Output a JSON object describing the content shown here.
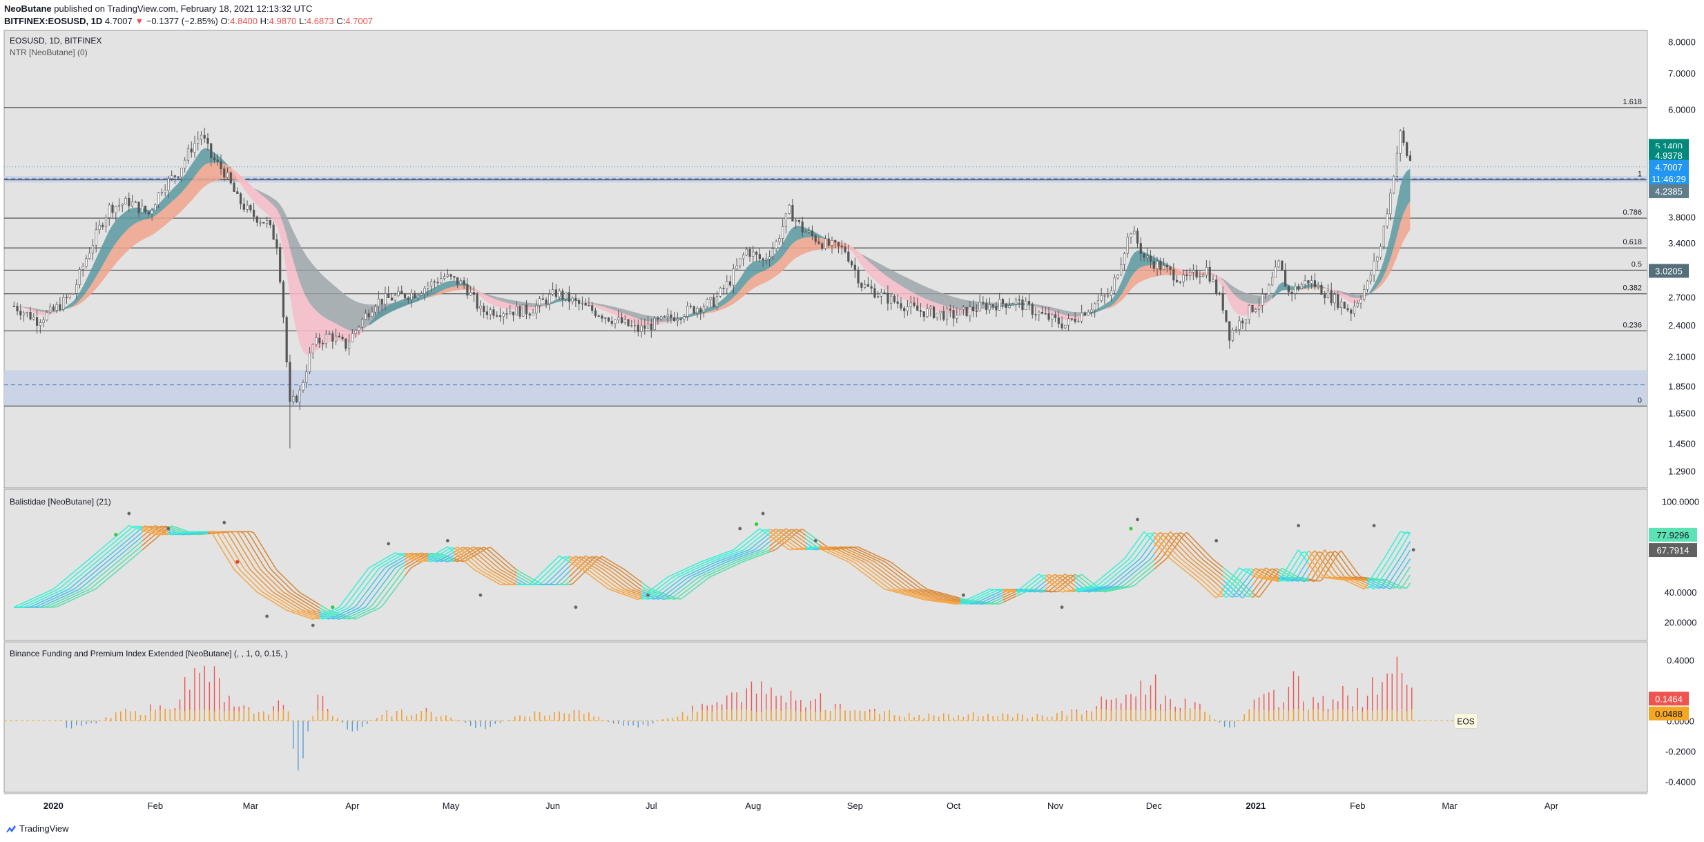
{
  "header": {
    "publisher": "NeoButane",
    "published_text": "published on TradingView.com, February 18, 2021 12:13:32 UTC",
    "symbol": "BITFINEX:EOSUSD, 1D",
    "last": "4.7007",
    "change": "−0.1377 (−2.85%)",
    "o_label": "O:",
    "o": "4.8400",
    "h_label": "H:",
    "h": "4.9870",
    "l_label": "L:",
    "l": "4.6873",
    "c_label": "C:",
    "c": "4.7007"
  },
  "colors": {
    "pane_bg": "#e3e3e3",
    "teal": "#5a9aa0",
    "salmon": "#f0a48c",
    "grey_band": "#9aa3a8",
    "pink": "#f7bcc8",
    "zone": "#c6d2e6",
    "candle": "#555555",
    "bar_red": "#ef5350",
    "bar_orange": "#f5a623",
    "bar_blue": "#5b9bd5"
  },
  "brand": "TradingView",
  "chart_data": [
    {
      "type": "candlestick",
      "pane": "price",
      "title": "EOSUSD, 1D, BITFINEX",
      "indicator_label": "NTR [NeoButane] (0)",
      "y_ticks": [
        "8.0000",
        "7.0000",
        "6.0000",
        "5.1400",
        "4.9378",
        "4.7007",
        "4.2385",
        "3.8000",
        "3.4000",
        "3.0205",
        "2.7000",
        "2.4000",
        "2.1000",
        "1.8500",
        "1.6500",
        "1.4500",
        "1.2900"
      ],
      "ylim": [
        1.2,
        8.4
      ],
      "log_scale": true,
      "fib_levels": [
        {
          "label": "1.618",
          "value": 6.05
        },
        {
          "label": "1",
          "value": 4.45
        },
        {
          "label": "0.786",
          "value": 3.78
        },
        {
          "label": "0.618",
          "value": 3.33
        },
        {
          "label": "0.5",
          "value": 3.03
        },
        {
          "label": "0.382",
          "value": 2.74
        },
        {
          "label": "0.236",
          "value": 2.34
        },
        {
          "label": "0",
          "value": 1.7
        }
      ],
      "price_tags": [
        {
          "text": "5.1400",
          "value": 5.14,
          "color": "#00897b"
        },
        {
          "text": "4.9378",
          "value": 4.9378,
          "color": "#00897b"
        },
        {
          "text": "4.7007",
          "value": 4.7007,
          "color": "#2196f3"
        },
        {
          "text": "11:46:29",
          "value": 4.47,
          "color": "#2196f3"
        },
        {
          "text": "4.2385",
          "value": 4.2385,
          "color": "#607d8b"
        },
        {
          "text": "3.0205",
          "value": 3.0205,
          "color": "#546e7a"
        }
      ],
      "close_series": [
        [
          "2019-12-20",
          2.6
        ],
        [
          "2019-12-27",
          2.45
        ],
        [
          "2020-01-01",
          2.55
        ],
        [
          "2020-01-07",
          2.75
        ],
        [
          "2020-01-12",
          3.3
        ],
        [
          "2020-01-18",
          3.95
        ],
        [
          "2020-01-24",
          4.05
        ],
        [
          "2020-01-30",
          3.85
        ],
        [
          "2020-02-03",
          4.3
        ],
        [
          "2020-02-08",
          4.6
        ],
        [
          "2020-02-12",
          5.1
        ],
        [
          "2020-02-15",
          5.4
        ],
        [
          "2020-02-18",
          4.9
        ],
        [
          "2020-02-22",
          4.6
        ],
        [
          "2020-02-26",
          4.1
        ],
        [
          "2020-03-01",
          3.85
        ],
        [
          "2020-03-06",
          3.7
        ],
        [
          "2020-03-09",
          3.4
        ],
        [
          "2020-03-12",
          2.05
        ],
        [
          "2020-03-13",
          1.7
        ],
        [
          "2020-03-16",
          1.8
        ],
        [
          "2020-03-20",
          2.2
        ],
        [
          "2020-03-25",
          2.3
        ],
        [
          "2020-03-30",
          2.2
        ],
        [
          "2020-04-03",
          2.4
        ],
        [
          "2020-04-08",
          2.65
        ],
        [
          "2020-04-14",
          2.7
        ],
        [
          "2020-04-20",
          2.75
        ],
        [
          "2020-04-29",
          2.95
        ],
        [
          "2020-05-05",
          2.85
        ],
        [
          "2020-05-10",
          2.55
        ],
        [
          "2020-05-17",
          2.55
        ],
        [
          "2020-05-25",
          2.55
        ],
        [
          "2020-06-02",
          2.75
        ],
        [
          "2020-06-10",
          2.6
        ],
        [
          "2020-06-20",
          2.45
        ],
        [
          "2020-06-27",
          2.35
        ],
        [
          "2020-07-05",
          2.45
        ],
        [
          "2020-07-12",
          2.55
        ],
        [
          "2020-07-20",
          2.65
        ],
        [
          "2020-07-25",
          2.9
        ],
        [
          "2020-07-30",
          3.3
        ],
        [
          "2020-08-04",
          3.15
        ],
        [
          "2020-08-08",
          3.4
        ],
        [
          "2020-08-12",
          3.9
        ],
        [
          "2020-08-16",
          3.6
        ],
        [
          "2020-08-22",
          3.4
        ],
        [
          "2020-08-29",
          3.3
        ],
        [
          "2020-09-03",
          2.85
        ],
        [
          "2020-09-10",
          2.7
        ],
        [
          "2020-09-20",
          2.55
        ],
        [
          "2020-10-01",
          2.5
        ],
        [
          "2020-10-10",
          2.6
        ],
        [
          "2020-10-20",
          2.65
        ],
        [
          "2020-10-28",
          2.5
        ],
        [
          "2020-11-04",
          2.4
        ],
        [
          "2020-11-10",
          2.55
        ],
        [
          "2020-11-18",
          2.75
        ],
        [
          "2020-11-24",
          3.6
        ],
        [
          "2020-11-28",
          3.2
        ],
        [
          "2020-12-04",
          3.05
        ],
        [
          "2020-12-10",
          2.9
        ],
        [
          "2020-12-17",
          3.05
        ],
        [
          "2020-12-22",
          2.6
        ],
        [
          "2020-12-24",
          2.3
        ],
        [
          "2020-12-30",
          2.55
        ],
        [
          "2021-01-04",
          2.7
        ],
        [
          "2021-01-08",
          3.1
        ],
        [
          "2021-01-11",
          2.75
        ],
        [
          "2021-01-17",
          2.9
        ],
        [
          "2021-01-24",
          2.7
        ],
        [
          "2021-01-30",
          2.55
        ],
        [
          "2021-02-04",
          2.85
        ],
        [
          "2021-02-08",
          3.35
        ],
        [
          "2021-02-11",
          4.2
        ],
        [
          "2021-02-14",
          5.4
        ],
        [
          "2021-02-16",
          4.95
        ],
        [
          "2021-02-18",
          4.7
        ]
      ]
    },
    {
      "type": "line",
      "pane": "oscillator",
      "title": "Balistidae [NeoButane] (21)",
      "y_ticks": [
        "100.0000",
        "77.9296",
        "67.7914",
        "40.0000",
        "20.0000"
      ],
      "ylim": [
        8,
        108
      ],
      "value_tags": [
        {
          "text": "77.9296",
          "value": 77.9296,
          "color": "#5be3b5"
        },
        {
          "text": "67.7914",
          "value": 67.7914,
          "color": "#616161"
        }
      ],
      "series": [
        [
          "2019-12-20",
          30
        ],
        [
          "2020-01-01",
          42
        ],
        [
          "2020-01-12",
          62
        ],
        [
          "2020-01-24",
          84
        ],
        [
          "2020-02-01",
          78
        ],
        [
          "2020-02-12",
          80
        ],
        [
          "2020-02-18",
          80
        ],
        [
          "2020-02-25",
          55
        ],
        [
          "2020-03-03",
          40
        ],
        [
          "2020-03-12",
          28
        ],
        [
          "2020-03-20",
          22
        ],
        [
          "2020-03-28",
          30
        ],
        [
          "2020-04-06",
          56
        ],
        [
          "2020-04-14",
          66
        ],
        [
          "2020-04-22",
          60
        ],
        [
          "2020-04-30",
          70
        ],
        [
          "2020-05-08",
          55
        ],
        [
          "2020-05-16",
          45
        ],
        [
          "2020-05-25",
          45
        ],
        [
          "2020-06-03",
          64
        ],
        [
          "2020-06-10",
          55
        ],
        [
          "2020-06-18",
          42
        ],
        [
          "2020-06-27",
          35
        ],
        [
          "2020-07-06",
          50
        ],
        [
          "2020-07-16",
          60
        ],
        [
          "2020-07-26",
          68
        ],
        [
          "2020-08-03",
          82
        ],
        [
          "2020-08-12",
          68
        ],
        [
          "2020-08-20",
          70
        ],
        [
          "2020-08-30",
          60
        ],
        [
          "2020-09-10",
          42
        ],
        [
          "2020-09-22",
          35
        ],
        [
          "2020-10-02",
          32
        ],
        [
          "2020-10-12",
          42
        ],
        [
          "2020-10-20",
          40
        ],
        [
          "2020-10-27",
          52
        ],
        [
          "2020-11-03",
          40
        ],
        [
          "2020-11-12",
          44
        ],
        [
          "2020-11-22",
          62
        ],
        [
          "2020-11-28",
          80
        ],
        [
          "2020-12-06",
          62
        ],
        [
          "2020-12-14",
          48
        ],
        [
          "2020-12-20",
          36
        ],
        [
          "2020-12-27",
          56
        ],
        [
          "2021-01-01",
          50
        ],
        [
          "2021-01-08",
          47
        ],
        [
          "2021-01-14",
          68
        ],
        [
          "2021-01-20",
          50
        ],
        [
          "2021-01-28",
          48
        ],
        [
          "2021-02-03",
          42
        ],
        [
          "2021-02-09",
          62
        ],
        [
          "2021-02-14",
          80
        ],
        [
          "2021-02-18",
          78
        ]
      ]
    },
    {
      "type": "bar",
      "pane": "funding",
      "title": "Binance Funding and Premium Index Extended [NeoButane] (, , 1, 0, 0.15, )",
      "y_ticks": [
        "0.4000",
        "0.1464",
        "0.0488",
        "0.0000",
        "-0.2000",
        "-0.4000"
      ],
      "ylim": [
        -0.47,
        0.52
      ],
      "value_tags": [
        {
          "text": "0.1464",
          "value": 0.1464,
          "color": "#ef5350"
        },
        {
          "text": "0.0488",
          "value": 0.0488,
          "color": "#f5a623"
        }
      ],
      "symbol_tag": "EOS",
      "premium_series": [
        [
          "2020-01-05",
          -0.06
        ],
        [
          "2020-01-12",
          -0.04
        ],
        [
          "2020-01-22",
          0.08
        ],
        [
          "2020-02-05",
          0.1
        ],
        [
          "2020-02-12",
          0.3
        ],
        [
          "2020-02-18",
          0.36
        ],
        [
          "2020-02-25",
          0.1
        ],
        [
          "2020-03-04",
          0.08
        ],
        [
          "2020-03-12",
          0.14
        ],
        [
          "2020-03-15",
          -0.38
        ],
        [
          "2020-03-22",
          0.2
        ],
        [
          "2020-04-01",
          -0.1
        ],
        [
          "2020-04-10",
          0.06
        ],
        [
          "2020-04-25",
          0.08
        ],
        [
          "2020-05-10",
          -0.06
        ],
        [
          "2020-05-25",
          0.06
        ],
        [
          "2020-06-10",
          0.08
        ],
        [
          "2020-06-25",
          -0.08
        ],
        [
          "2020-07-10",
          0.06
        ],
        [
          "2020-07-25",
          0.18
        ],
        [
          "2020-08-04",
          0.24
        ],
        [
          "2020-08-14",
          0.2
        ],
        [
          "2020-08-28",
          0.12
        ],
        [
          "2020-09-10",
          0.06
        ],
        [
          "2020-09-25",
          0.04
        ],
        [
          "2020-10-10",
          0.05
        ],
        [
          "2020-10-25",
          0.04
        ],
        [
          "2020-11-10",
          0.08
        ],
        [
          "2020-11-20",
          0.2
        ],
        [
          "2020-11-27",
          0.26
        ],
        [
          "2020-11-30",
          0.36
        ],
        [
          "2020-12-06",
          0.15
        ],
        [
          "2020-12-15",
          0.1
        ],
        [
          "2020-12-24",
          -0.08
        ],
        [
          "2020-12-30",
          0.1
        ],
        [
          "2021-01-06",
          0.18
        ],
        [
          "2021-01-12",
          0.3
        ],
        [
          "2021-01-18",
          0.14
        ],
        [
          "2021-01-26",
          0.2
        ],
        [
          "2021-02-03",
          0.22
        ],
        [
          "2021-02-09",
          0.3
        ],
        [
          "2021-02-15",
          0.38
        ],
        [
          "2021-02-18",
          0.15
        ]
      ]
    }
  ],
  "x_axis": {
    "ticks": [
      {
        "label": "2020",
        "date": "2020-01-01",
        "bold": true
      },
      {
        "label": "Feb",
        "date": "2020-02-01"
      },
      {
        "label": "Mar",
        "date": "2020-03-01"
      },
      {
        "label": "Apr",
        "date": "2020-04-01"
      },
      {
        "label": "May",
        "date": "2020-05-01"
      },
      {
        "label": "Jun",
        "date": "2020-06-01"
      },
      {
        "label": "Jul",
        "date": "2020-07-01"
      },
      {
        "label": "Aug",
        "date": "2020-08-01"
      },
      {
        "label": "Sep",
        "date": "2020-09-01"
      },
      {
        "label": "Oct",
        "date": "2020-10-01"
      },
      {
        "label": "Nov",
        "date": "2020-11-01"
      },
      {
        "label": "Dec",
        "date": "2020-12-01"
      },
      {
        "label": "2021",
        "date": "2021-01-01",
        "bold": true
      },
      {
        "label": "Feb",
        "date": "2021-02-01"
      },
      {
        "label": "Mar",
        "date": "2021-03-01"
      },
      {
        "label": "Apr",
        "date": "2021-04-01"
      }
    ]
  }
}
